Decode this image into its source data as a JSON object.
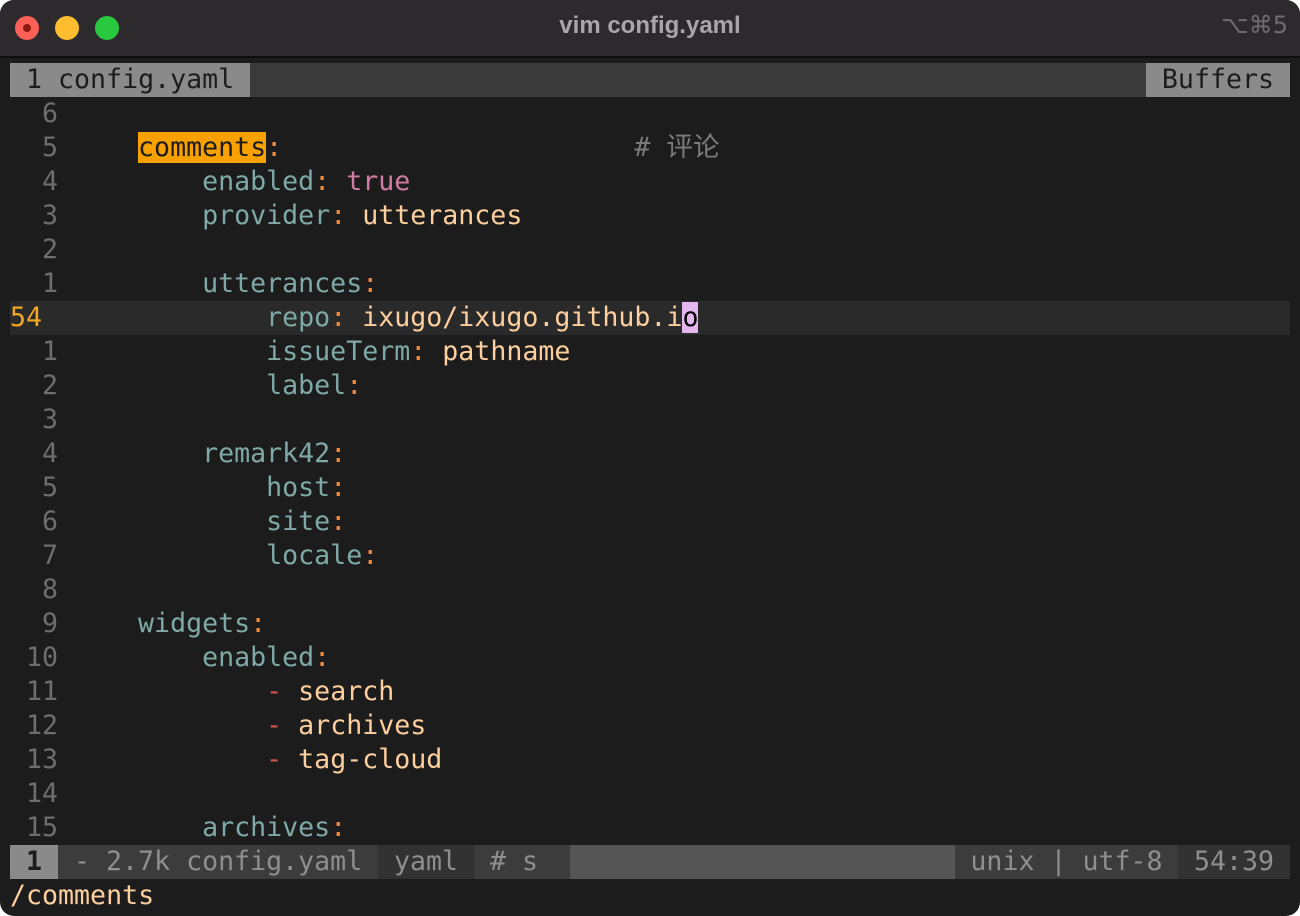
{
  "window": {
    "title": "vim config.yaml",
    "shortcut": "⌥⌘5"
  },
  "tabline": {
    "active_tab": "1 config.yaml",
    "buffers_label": "Buffers"
  },
  "colors": {
    "key": "#7fa9a6",
    "punct": "#f08a3c",
    "string": "#fdcf9e",
    "bool": "#d07ba3",
    "dash": "#d9534f",
    "search_highlight": "#f8a100",
    "cursor": "#e4b6f0",
    "current_line_number": "#f5a623"
  },
  "lines": [
    {
      "num": "6",
      "indent": 0,
      "tokens": []
    },
    {
      "num": "5",
      "indent": 1,
      "tokens": [
        {
          "t": "comments",
          "c": "k hl"
        },
        {
          "t": ":",
          "c": "p"
        },
        {
          "t": "                      ",
          "c": ""
        },
        {
          "t": "# 评论",
          "c": "c"
        }
      ]
    },
    {
      "num": "4",
      "indent": 2,
      "tokens": [
        {
          "t": "enabled",
          "c": "k"
        },
        {
          "t": ": ",
          "c": "p"
        },
        {
          "t": "true",
          "c": "b"
        }
      ]
    },
    {
      "num": "3",
      "indent": 2,
      "tokens": [
        {
          "t": "provider",
          "c": "k"
        },
        {
          "t": ": ",
          "c": "p"
        },
        {
          "t": "utterances",
          "c": "s"
        }
      ]
    },
    {
      "num": "2",
      "indent": 0,
      "tokens": []
    },
    {
      "num": "1",
      "indent": 2,
      "tokens": [
        {
          "t": "utterances",
          "c": "k"
        },
        {
          "t": ":",
          "c": "p"
        }
      ]
    },
    {
      "num": "54",
      "indent": 3,
      "current": true,
      "tokens": [
        {
          "t": "repo",
          "c": "k"
        },
        {
          "t": ": ",
          "c": "p"
        },
        {
          "t": "ixugo/ixugo.github.i",
          "c": "s"
        },
        {
          "t": "o",
          "c": "cursor"
        }
      ]
    },
    {
      "num": "1",
      "indent": 3,
      "tokens": [
        {
          "t": "issueTerm",
          "c": "k"
        },
        {
          "t": ": ",
          "c": "p"
        },
        {
          "t": "pathname",
          "c": "s"
        }
      ]
    },
    {
      "num": "2",
      "indent": 3,
      "tokens": [
        {
          "t": "label",
          "c": "k"
        },
        {
          "t": ":",
          "c": "p"
        }
      ]
    },
    {
      "num": "3",
      "indent": 0,
      "tokens": []
    },
    {
      "num": "4",
      "indent": 2,
      "tokens": [
        {
          "t": "remark42",
          "c": "k"
        },
        {
          "t": ":",
          "c": "p"
        }
      ]
    },
    {
      "num": "5",
      "indent": 3,
      "tokens": [
        {
          "t": "host",
          "c": "k"
        },
        {
          "t": ":",
          "c": "p"
        }
      ]
    },
    {
      "num": "6",
      "indent": 3,
      "tokens": [
        {
          "t": "site",
          "c": "k"
        },
        {
          "t": ":",
          "c": "p"
        }
      ]
    },
    {
      "num": "7",
      "indent": 3,
      "tokens": [
        {
          "t": "locale",
          "c": "k"
        },
        {
          "t": ":",
          "c": "p"
        }
      ]
    },
    {
      "num": "8",
      "indent": 0,
      "tokens": []
    },
    {
      "num": "9",
      "indent": 1,
      "tokens": [
        {
          "t": "widgets",
          "c": "k"
        },
        {
          "t": ":",
          "c": "p"
        }
      ]
    },
    {
      "num": "10",
      "indent": 2,
      "tokens": [
        {
          "t": "enabled",
          "c": "k"
        },
        {
          "t": ":",
          "c": "p"
        }
      ]
    },
    {
      "num": "11",
      "indent": 3,
      "tokens": [
        {
          "t": "- ",
          "c": "d"
        },
        {
          "t": "search",
          "c": "s"
        }
      ]
    },
    {
      "num": "12",
      "indent": 3,
      "tokens": [
        {
          "t": "- ",
          "c": "d"
        },
        {
          "t": "archives",
          "c": "s"
        }
      ]
    },
    {
      "num": "13",
      "indent": 3,
      "tokens": [
        {
          "t": "- ",
          "c": "d"
        },
        {
          "t": "tag-cloud",
          "c": "s"
        }
      ]
    },
    {
      "num": "14",
      "indent": 0,
      "tokens": []
    },
    {
      "num": "15",
      "indent": 2,
      "tokens": [
        {
          "t": "archives",
          "c": "k"
        },
        {
          "t": ":",
          "c": "p"
        }
      ]
    }
  ],
  "statusline": {
    "buffer_num": "1",
    "file_info": " - 2.7k config.yaml",
    "filetype": "yaml",
    "extra": "# s",
    "encoding": "unix | utf-8",
    "position": "54:39"
  },
  "cmdline": "/comments"
}
